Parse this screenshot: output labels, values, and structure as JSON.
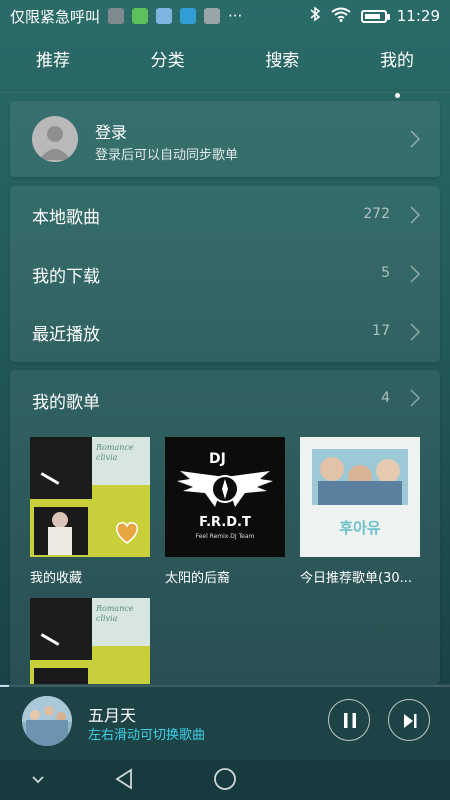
{
  "status_bar": {
    "carrier": "仅限紧急呼叫",
    "more": "···",
    "time": "11:29",
    "battery_level": 0.85
  },
  "tabs": [
    {
      "label": "推荐"
    },
    {
      "label": "分类"
    },
    {
      "label": "搜索"
    },
    {
      "label": "我的",
      "active": true
    }
  ],
  "login": {
    "title": "登录",
    "subtitle": "登录后可以自动同步歌单"
  },
  "library": [
    {
      "label": "本地歌曲",
      "count": "272"
    },
    {
      "label": "我的下载",
      "count": "5"
    },
    {
      "label": "最近播放",
      "count": "17"
    }
  ],
  "playlists": {
    "title": "我的歌单",
    "count": "4",
    "items": [
      {
        "label": "我的收藏",
        "cover_text": "Romance\nclivia"
      },
      {
        "label": "太阳的后裔",
        "cover_text": "F.R.D.T",
        "cover_sub": "Feel Remix DJ Team",
        "cover_top": "DJ"
      },
      {
        "label": "今日推荐歌单(30...",
        "cover_text": "후아유"
      },
      {
        "label": "",
        "cover_text": "Romance\nclivia"
      }
    ]
  },
  "now_playing": {
    "title": "五月天",
    "hint": "左右滑动可切换歌曲",
    "progress": 0.02
  },
  "colors": {
    "accent": "#3fd0e6",
    "background": "#245c5b"
  }
}
